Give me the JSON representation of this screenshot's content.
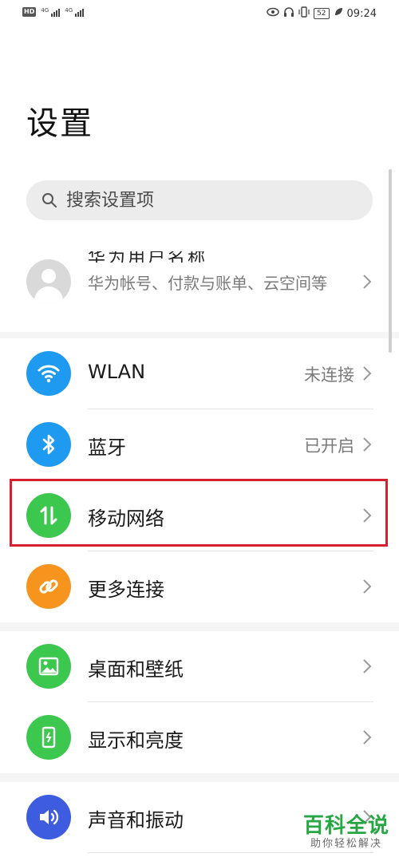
{
  "status_bar": {
    "left_badge": "HD",
    "signal1_label": "4G",
    "signal2_label": "4G",
    "battery": "52",
    "time": "09:24"
  },
  "page": {
    "title": "设置"
  },
  "search": {
    "placeholder": "搜索设置项"
  },
  "account": {
    "name": "华为用户名称",
    "subtitle": "华为帐号、付款与账单、云空间等"
  },
  "section1": {
    "items": [
      {
        "label": "WLAN",
        "value": "未连接",
        "icon": "wifi-icon",
        "color": "#1e9bf0"
      },
      {
        "label": "蓝牙",
        "value": "已开启",
        "icon": "bluetooth-icon",
        "color": "#1e9bf0"
      },
      {
        "label": "移动网络",
        "value": "",
        "icon": "mobile-data-icon",
        "color": "#3cc74e"
      },
      {
        "label": "更多连接",
        "value": "",
        "icon": "link-icon",
        "color": "#f7941d"
      }
    ]
  },
  "section2": {
    "items": [
      {
        "label": "桌面和壁纸",
        "icon": "wallpaper-icon",
        "color": "#3cc74e"
      },
      {
        "label": "显示和亮度",
        "icon": "display-icon",
        "color": "#3cc74e"
      }
    ]
  },
  "section3": {
    "items": [
      {
        "label": "声音和振动",
        "icon": "sound-icon",
        "color": "#3d5ce0"
      }
    ]
  },
  "watermark": {
    "title": "百科全说",
    "subtitle": "助你轻松解决"
  },
  "colors": {
    "highlight": "#d6202f",
    "background": "#f5f5f5"
  }
}
